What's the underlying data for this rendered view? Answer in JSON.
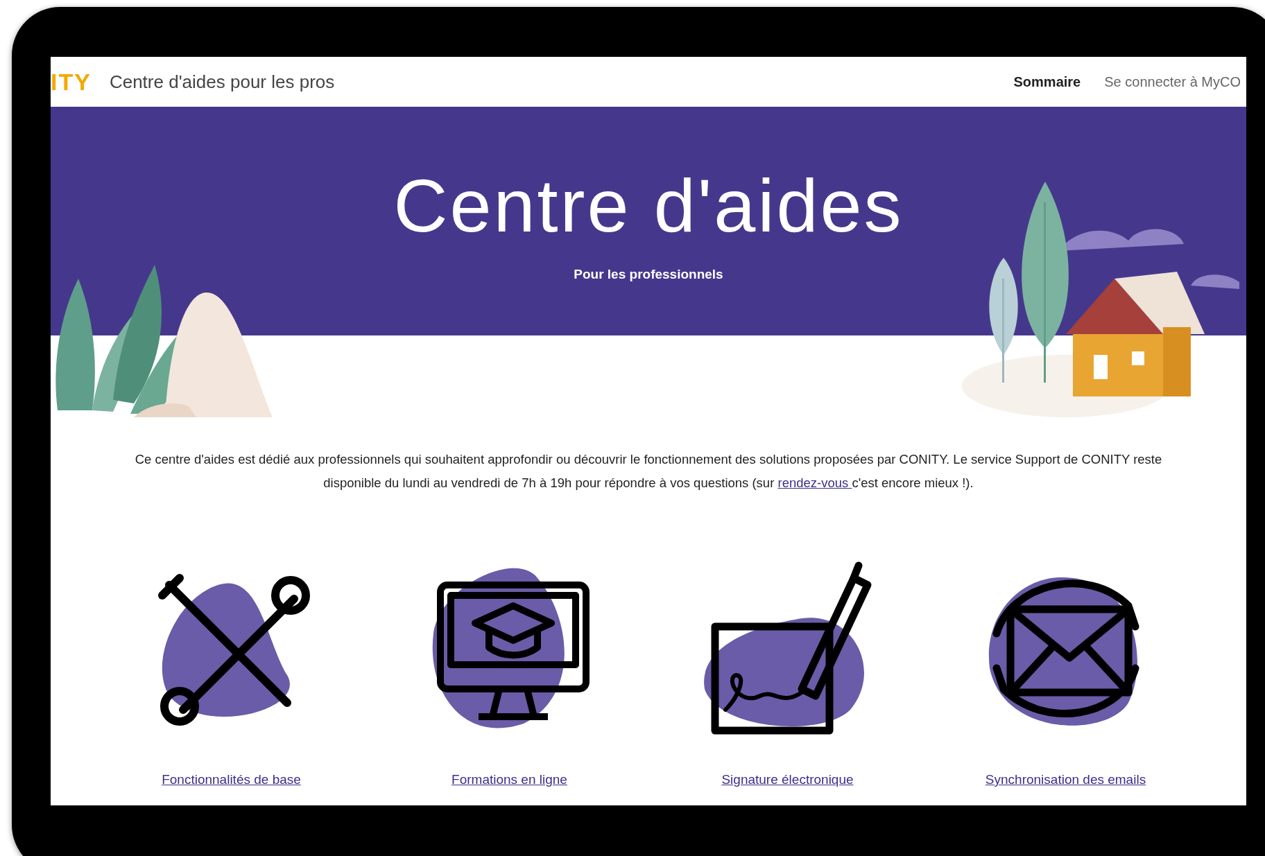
{
  "header": {
    "logo": "ITY",
    "title": "Centre d'aides pour les pros",
    "nav": [
      {
        "label": "Sommaire",
        "selected": true
      },
      {
        "label": "Se connecter à MyCO",
        "selected": false
      }
    ]
  },
  "hero": {
    "title": "Centre d'aides",
    "subtitle": "Pour les professionnels"
  },
  "intro": {
    "before": "Ce centre d'aides est dédié aux professionnels qui souhaitent approfondir ou découvrir le fonctionnement des solutions proposées par CONITY. Le service Support de CONITY reste disponible du lundi au vendredi de 7h à 19h pour répondre à vos questions (sur ",
    "link": "rendez-vous ",
    "after": "c'est encore mieux !)."
  },
  "categories": [
    {
      "kind": "tools",
      "label": "Fonctionnalités de base"
    },
    {
      "kind": "training",
      "label": "Formations en ligne"
    },
    {
      "kind": "signature",
      "label": "Signature électronique"
    },
    {
      "kind": "email",
      "label": "Synchronisation des emails"
    }
  ]
}
